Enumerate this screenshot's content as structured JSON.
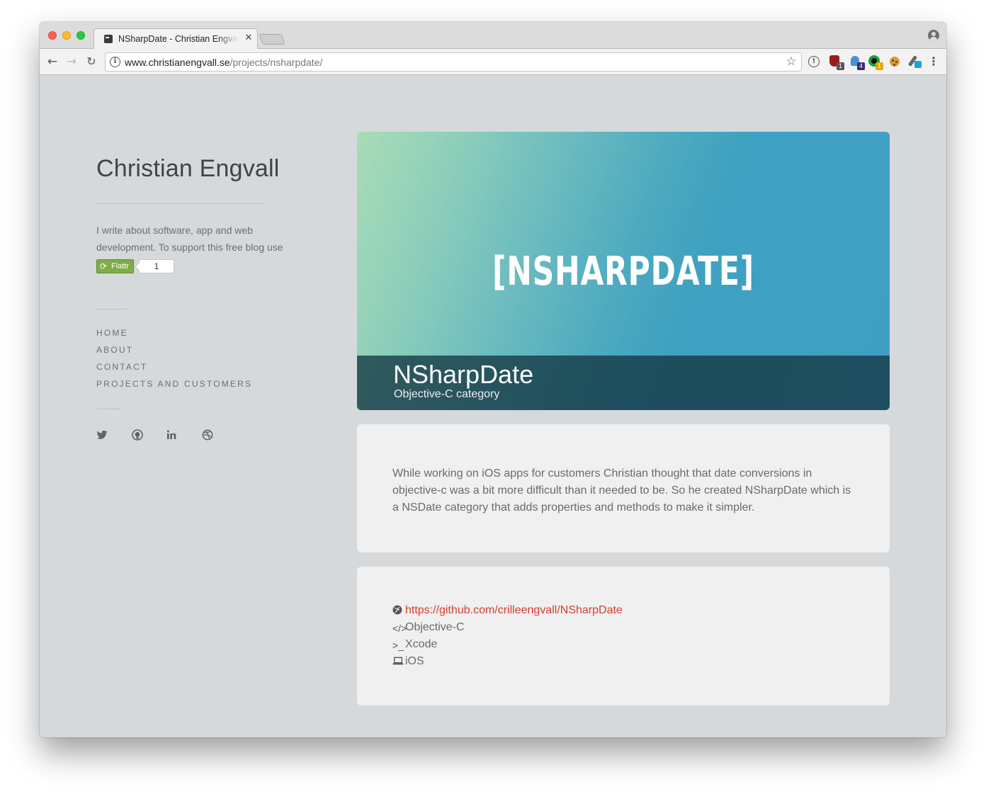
{
  "browser": {
    "tab": {
      "title": "NSharpDate - Christian Engvall",
      "close": "✕"
    },
    "address_bar": {
      "host": "www.christianengvall.se",
      "path": "/projects/nsharpdate/"
    },
    "extension_badges": [
      "1",
      "4",
      "1"
    ],
    "icons": {
      "back": "arrow-left-icon",
      "forward": "arrow-right-icon",
      "reload": "reload-icon",
      "info": "info-icon",
      "bookmark": "star-icon",
      "menu": "kebab-menu-icon",
      "profile": "profile-icon"
    }
  },
  "sidebar": {
    "site_title": "Christian Engvall",
    "tagline": "I write about software, app and web development. To support this free blog use",
    "flattr": {
      "label": "Flattr",
      "count": "1"
    },
    "nav": [
      {
        "label": "HOME"
      },
      {
        "label": "ABOUT"
      },
      {
        "label": "CONTACT"
      },
      {
        "label": "PROJECTS AND CUSTOMERS"
      }
    ],
    "social": [
      "twitter-icon",
      "github-icon",
      "linkedin-icon",
      "dribbble-icon"
    ]
  },
  "project": {
    "logo_text": "[NSHARPDATE]",
    "title": "NSharpDate",
    "subtitle": "Objective-C category",
    "description": "While working on iOS apps for customers Christian thought that date conversions in objective-c was a bit more difficult than it needed to be. So he created NSharpDate which is a NSDate category that adds properties and methods to make it simpler.",
    "meta": {
      "link": "https://github.com/crilleengvall/NSharpDate",
      "language": "Objective-C",
      "tool": "Xcode",
      "platform": "iOS"
    }
  },
  "colors": {
    "page_background": "#d5d9dc",
    "card_background": "#f0f0f0",
    "link": "#d83b2f",
    "flattr_green": "#7fac45",
    "hero_gradient_start": "#a8dcb6",
    "hero_gradient_end": "#3f9fc2"
  }
}
